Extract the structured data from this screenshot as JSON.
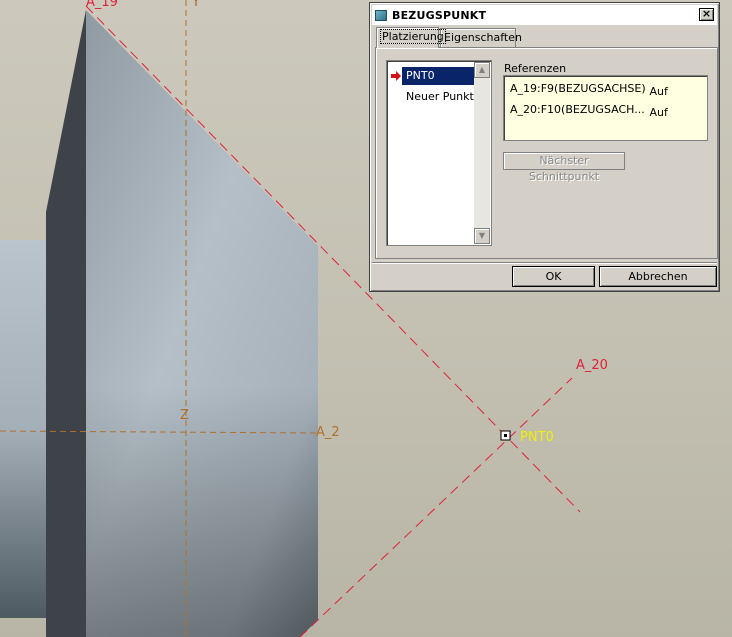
{
  "viewport": {
    "axis_labels": {
      "a19": "A_19",
      "a20": "A_20",
      "a2": "A_2",
      "y": "Y",
      "z": "Z"
    },
    "point_label": "PNT0",
    "colors": {
      "datum_axis": "#e0203a",
      "csys_axis": "#b0702c",
      "point_label": "#f0f000"
    }
  },
  "dialog": {
    "title": "BEZUGSPUNKT",
    "title_icon": "datum-point-icon",
    "close_label": "×",
    "tabs": [
      "Platzierung",
      "Eigenschaften"
    ],
    "active_tab": "Platzierung",
    "point_list": {
      "items": [
        "PNT0",
        "Neuer Punkt"
      ],
      "selected": "PNT0"
    },
    "references": {
      "label": "Referenzen",
      "rows": [
        {
          "name": "A_19:F9(BEZUGSACHSE)",
          "constraint": "Auf"
        },
        {
          "name": "A_20:F10(BEZUGSACH...",
          "constraint": "Auf"
        }
      ]
    },
    "next_intersection_label": "Nächster Schnittpunkt",
    "ok_label": "OK",
    "cancel_label": "Abbrechen"
  }
}
